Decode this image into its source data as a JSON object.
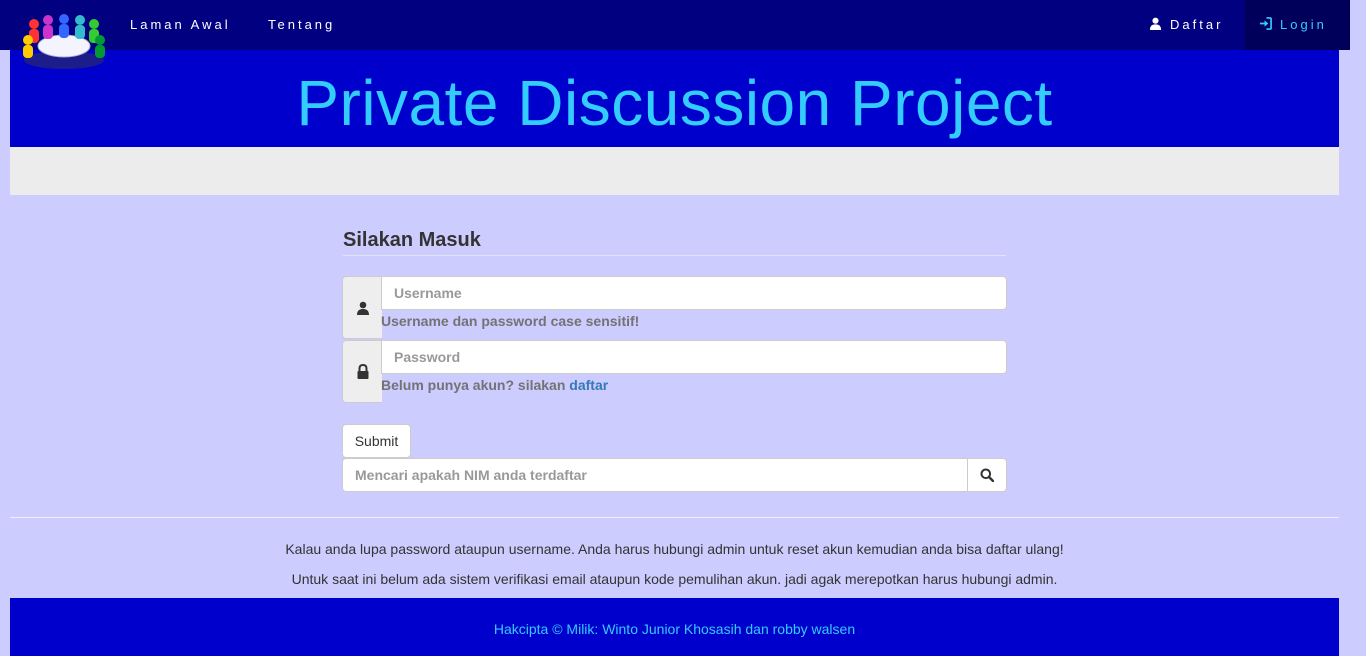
{
  "nav": {
    "home": "Laman Awal",
    "about": "Tentang",
    "register": "Daftar",
    "login": "Login"
  },
  "header": {
    "title": "Private Discussion Project"
  },
  "login_form": {
    "title": "Silakan Masuk",
    "username_placeholder": "Username",
    "username_help": "Username dan password case sensitif!",
    "password_placeholder": "Password",
    "register_prompt": "Belum punya akun? silakan",
    "register_link": "daftar",
    "submit_label": "Submit",
    "search_placeholder": "Mencari apakah NIM anda terdaftar"
  },
  "notices": [
    "Kalau anda lupa password ataupun username. Anda harus hubungi admin untuk reset akun kemudian anda bisa daftar ulang!",
    "Untuk saat ini belum ada sistem verifikasi email ataupun kode pemulihan akun. jadi agak merepotkan harus hubungi admin."
  ],
  "footer": {
    "copyright": "Hakcipta © Milik: Winto Junior Khosasih dan robby walsen"
  },
  "colors": {
    "navbar": "#000080",
    "header": "#0000cc",
    "accent": "#33ccff",
    "page_bg": "#ccccff"
  },
  "icons": {
    "logo": "people-around-table-logo",
    "register": "user-icon",
    "login": "login-icon",
    "username": "user-icon",
    "password": "lock-icon",
    "search": "search-icon"
  }
}
